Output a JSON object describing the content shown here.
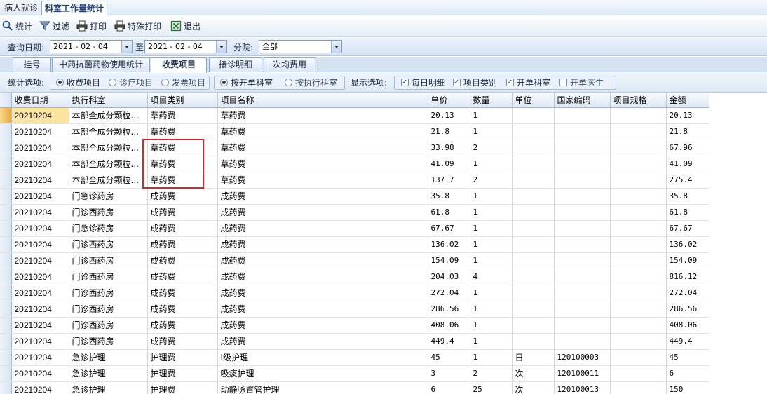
{
  "doc_tabs": [
    "病人就诊",
    "科室工作量统计"
  ],
  "toolbar": {
    "stats": "统计",
    "filter": "过滤",
    "print": "打印",
    "special_print": "特殊打印",
    "exit": "退出"
  },
  "query": {
    "date_label": "查询日期:",
    "from_date": "2021 - 02 - 04",
    "to_label": "至",
    "to_date": "2021 - 02 - 04",
    "branch_label": "分院:",
    "branch_value": "全部"
  },
  "sub_tabs": [
    "挂号",
    "中药抗菌药物使用统计",
    "收费项目",
    "接诊明细",
    "次均费用"
  ],
  "options": {
    "stat_label": "统计选项:",
    "stat_items": [
      "收费项目",
      "诊疗项目",
      "发票项目"
    ],
    "dept_items": [
      "按开单科室",
      "按执行科室"
    ],
    "display_label": "显示选项:",
    "display_items": [
      "每日明细",
      "项目类别",
      "开单科室",
      "开单医生"
    ]
  },
  "table": {
    "columns": [
      "收费日期",
      "执行科室",
      "项目类别",
      "项目名称",
      "单价",
      "数量",
      "单位",
      "国家编码",
      "项目规格",
      "金额"
    ],
    "rows": [
      [
        "20210204",
        "本部全成分颗粒...",
        "草药费",
        "草药费",
        "20.13",
        "1",
        "",
        "",
        "",
        "20.13"
      ],
      [
        "20210204",
        "本部全成分颗粒...",
        "草药费",
        "草药费",
        "21.8",
        "1",
        "",
        "",
        "",
        "21.8"
      ],
      [
        "20210204",
        "本部全成分颗粒...",
        "草药费",
        "草药费",
        "33.98",
        "2",
        "",
        "",
        "",
        "67.96"
      ],
      [
        "20210204",
        "本部全成分颗粒...",
        "草药费",
        "草药费",
        "41.09",
        "1",
        "",
        "",
        "",
        "41.09"
      ],
      [
        "20210204",
        "本部全成分颗粒...",
        "草药费",
        "草药费",
        "137.7",
        "2",
        "",
        "",
        "",
        "275.4"
      ],
      [
        "20210204",
        "门急诊药房",
        "成药费",
        "成药费",
        "35.8",
        "1",
        "",
        "",
        "",
        "35.8"
      ],
      [
        "20210204",
        "门诊西药房",
        "成药费",
        "成药费",
        "61.8",
        "1",
        "",
        "",
        "",
        "61.8"
      ],
      [
        "20210204",
        "门急诊药房",
        "成药费",
        "成药费",
        "67.67",
        "1",
        "",
        "",
        "",
        "67.67"
      ],
      [
        "20210204",
        "门诊西药房",
        "成药费",
        "成药费",
        "136.02",
        "1",
        "",
        "",
        "",
        "136.02"
      ],
      [
        "20210204",
        "门诊西药房",
        "成药费",
        "成药费",
        "154.09",
        "1",
        "",
        "",
        "",
        "154.09"
      ],
      [
        "20210204",
        "门诊西药房",
        "成药费",
        "成药费",
        "204.03",
        "4",
        "",
        "",
        "",
        "816.12"
      ],
      [
        "20210204",
        "门诊西药房",
        "成药费",
        "成药费",
        "272.04",
        "1",
        "",
        "",
        "",
        "272.04"
      ],
      [
        "20210204",
        "门诊西药房",
        "成药费",
        "成药费",
        "286.56",
        "1",
        "",
        "",
        "",
        "286.56"
      ],
      [
        "20210204",
        "门诊西药房",
        "成药费",
        "成药费",
        "408.06",
        "1",
        "",
        "",
        "",
        "408.06"
      ],
      [
        "20210204",
        "门诊西药房",
        "成药费",
        "成药费",
        "449.4",
        "1",
        "",
        "",
        "",
        "449.4"
      ],
      [
        "20210204",
        "急诊护理",
        "护理费",
        "Ⅰ级护理",
        "45",
        "1",
        "日",
        "120100003",
        "",
        "45"
      ],
      [
        "20210204",
        "急诊护理",
        "护理费",
        "吸痰护理",
        "3",
        "2",
        "次",
        "120100011",
        "",
        "6"
      ],
      [
        "20210204",
        "急诊护理",
        "护理费",
        "动静脉置管护理",
        "6",
        "25",
        "次",
        "120100013",
        "",
        "150"
      ]
    ]
  },
  "colors": {
    "highlight_box": "#e0232b",
    "selected_row": "#fbe3a0"
  }
}
